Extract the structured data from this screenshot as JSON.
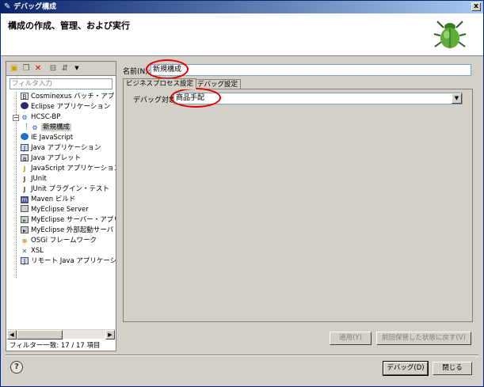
{
  "window": {
    "title": "デバッグ構成",
    "close_label": "x"
  },
  "banner": {
    "title": "構成の作成、管理、および実行",
    "icon": "ladybug-icon"
  },
  "left": {
    "toolbar": [
      "new-config-icon",
      "duplicate-icon",
      "delete-icon",
      "collapse-icon",
      "filter-icon"
    ],
    "filter_placeholder": "フィルタ入力",
    "tree": [
      {
        "label": "Cosminexus バッチ・アプリケ",
        "icon": "batch-icon",
        "level": 1
      },
      {
        "label": "Eclipse アプリケーション",
        "icon": "eclipse-icon",
        "level": 1
      },
      {
        "label": "HCSC-BP",
        "icon": "hcsc-icon",
        "level": 1,
        "expanded": true
      },
      {
        "label": "新規構成",
        "icon": "config-icon",
        "level": 2,
        "selected": true
      },
      {
        "label": "IE JavaScript",
        "icon": "ie-icon",
        "level": 1
      },
      {
        "label": "Java アプリケーション",
        "icon": "java-app-icon",
        "level": 1
      },
      {
        "label": "Java アプレット",
        "icon": "applet-icon",
        "level": 1
      },
      {
        "label": "JavaScript アプリケーション",
        "icon": "js-icon",
        "level": 1
      },
      {
        "label": "JUnit",
        "icon": "junit-icon",
        "level": 1
      },
      {
        "label": "JUnit プラグイン・テスト",
        "icon": "junit-plugin-icon",
        "level": 1
      },
      {
        "label": "Maven ビルド",
        "icon": "maven-icon",
        "level": 1
      },
      {
        "label": "MyEclipse Server",
        "icon": "server-icon",
        "level": 1
      },
      {
        "label": "MyEclipse サーバー・アプリケ",
        "icon": "server-app-icon",
        "level": 1
      },
      {
        "label": "MyEclipse 外部起動サーバ",
        "icon": "external-server-icon",
        "level": 1
      },
      {
        "label": "OSGi フレームワーク",
        "icon": "osgi-icon",
        "level": 1
      },
      {
        "label": "XSL",
        "icon": "xsl-icon",
        "level": 1
      },
      {
        "label": "リモート Java アプリケーショ",
        "icon": "remote-java-icon",
        "level": 1
      }
    ],
    "filter_status": "フィルター一致: 17 / 17 項目"
  },
  "right": {
    "name_label": "名前(N):",
    "name_value": "新規構成",
    "tabs": [
      {
        "label": "ビジネスプロセス設定",
        "active": true
      },
      {
        "label": "デバッグ設定",
        "active": false
      }
    ],
    "debug_target_label": "デバッグ対象:",
    "debug_target_value": "商品手配",
    "apply_button": "適用(Y)",
    "revert_button": "前回保管した状態に戻す(V)"
  },
  "footer": {
    "help_icon": "help-icon",
    "help_label": "?",
    "debug_button": "デバッグ(D)",
    "close_button": "閉じる"
  },
  "colors": {
    "title_gradient_start": "#0a246a",
    "title_gradient_end": "#a6caf0",
    "annotation_red": "#e00000",
    "panel_bg": "#d4d0c8"
  }
}
